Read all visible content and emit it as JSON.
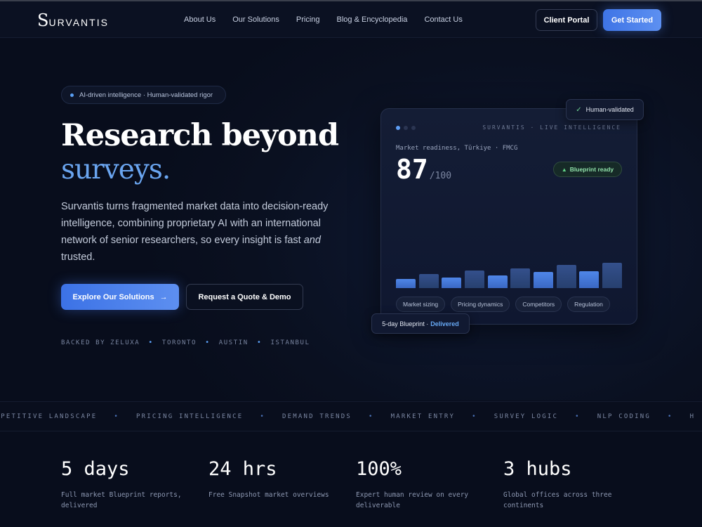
{
  "nav": {
    "logo_initial": "S",
    "logo_rest": "URVANTIS",
    "links": [
      "About Us",
      "Our Solutions",
      "Pricing",
      "Blog & Encyclopedia",
      "Contact Us"
    ],
    "portal_label": "Client Portal",
    "start_label": "Get Started"
  },
  "hero": {
    "pill": "AI-driven intelligence · Human-validated rigor",
    "title_line1": "Research beyond",
    "title_line2": "surveys.",
    "lead_main": "Survantis turns fragmented market data into decision-ready intelligence, combining proprietary AI with an international network of senior researchers, so every insight is fast ",
    "lead_em": "and",
    "lead_end": " trusted.",
    "explore_label": "Explore Our Solutions",
    "explore_arrow": "→",
    "quote_label": "Request a Quote & Demo",
    "backed": [
      "BACKED BY ZELUXA",
      "TORONTO",
      "AUSTIN",
      "ISTANBUL"
    ],
    "backed_sep": "•"
  },
  "card": {
    "brand": "SURVANTIS · LIVE INTELLIGENCE",
    "metric_label": "Market readiness, Türkiye · FMCG",
    "metric_value": "87",
    "metric_max": "/100",
    "badge": "Blueprint ready",
    "badge_icon": "▲",
    "bars": [
      0.28,
      0.44,
      0.33,
      0.56,
      0.4,
      0.62,
      0.5,
      0.74,
      0.54,
      0.8
    ],
    "tags": [
      "Market sizing",
      "Pricing dynamics",
      "Competitors",
      "Regulation"
    ],
    "validated_icon": "✓",
    "validated": "Human-validated",
    "delivered_prefix": "5-day Blueprint ·",
    "delivered_status": "Delivered"
  },
  "ticker": {
    "items": [
      "OMPETITIVE LANDSCAPE",
      "PRICING INTELLIGENCE",
      "DEMAND TRENDS",
      "MARKET ENTRY",
      "SURVEY LOGIC",
      "NLP CODING",
      "H"
    ],
    "sep": "•"
  },
  "stats": [
    {
      "value": "5 days",
      "desc": "Full market Blueprint reports, delivered"
    },
    {
      "value": "24 hrs",
      "desc": "Free Snapshot market overviews"
    },
    {
      "value": "100%",
      "desc": "Expert human review on every deliverable"
    },
    {
      "value": "3 hubs",
      "desc": "Global offices across three continents"
    }
  ],
  "colors": {
    "accent": "#5d8ff0",
    "highlight": "#6aa5f0",
    "success": "#8fe0a8"
  }
}
